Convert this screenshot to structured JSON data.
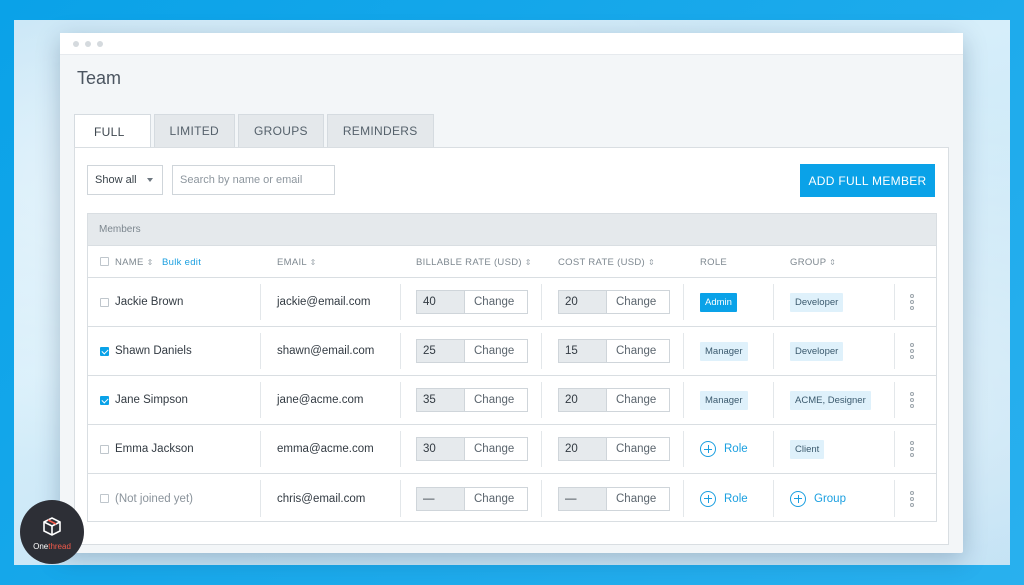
{
  "page": {
    "title": "Team"
  },
  "tabs": [
    {
      "label": "FULL",
      "active": true
    },
    {
      "label": "LIMITED",
      "active": false
    },
    {
      "label": "GROUPS",
      "active": false
    },
    {
      "label": "REMINDERS",
      "active": false
    }
  ],
  "toolbar": {
    "filter_value": "Show all",
    "search_placeholder": "Search by name or email",
    "add_button_label": "ADD FULL MEMBER"
  },
  "table": {
    "section_label": "Members",
    "columns": {
      "name": "NAME",
      "bulk_edit": "Bulk edit",
      "email": "EMAIL",
      "billable_rate": "BILLABLE RATE (USD)",
      "cost_rate": "COST RATE (USD)",
      "role": "ROLE",
      "group": "GROUP"
    },
    "sort_glyph": "⇕",
    "change_label": "Change",
    "role_add_label": "Role",
    "group_add_label": "Group",
    "rows": [
      {
        "checked": false,
        "name": "Jackie Brown",
        "email": "jackie@email.com",
        "billable": "40",
        "cost": "20",
        "role": "Admin",
        "group": "Developer"
      },
      {
        "checked": true,
        "name": "Shawn Daniels",
        "email": "shawn@email.com",
        "billable": "25",
        "cost": "15",
        "role": "Manager",
        "group": "Developer"
      },
      {
        "checked": true,
        "name": "Jane Simpson",
        "email": "jane@acme.com",
        "billable": "35",
        "cost": "20",
        "role": "Manager",
        "group": "ACME, Designer"
      },
      {
        "checked": false,
        "name": "Emma Jackson",
        "email": "emma@acme.com",
        "billable": "30",
        "cost": "20",
        "role": "",
        "group": "Client"
      },
      {
        "checked": false,
        "name": "(Not joined yet)",
        "email": "chris@email.com",
        "billable": "—",
        "cost": "—",
        "role": "",
        "group": ""
      }
    ]
  },
  "brand": {
    "name_part1": "One",
    "name_part2": "thread"
  },
  "colors": {
    "accent": "#0aa2e8",
    "brand_red": "#f25a4a"
  }
}
